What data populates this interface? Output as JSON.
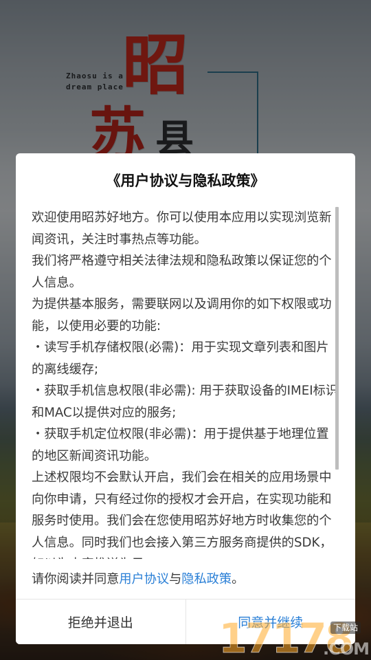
{
  "background": {
    "caption": "Zhaosu is a dream place",
    "calligraphy": [
      "昭",
      "苏",
      "县"
    ]
  },
  "dialog": {
    "title": "《用户协议与隐私政策》",
    "paragraphs": [
      "欢迎使用昭苏好地方。你可以使用本应用以实现浏览新闻资讯，关注时事热点等功能。",
      "我们将严格遵守相关法律法规和隐私政策以保证您的个人信息。",
      "为提供基本服务，需要联网以及调用你的如下权限或功能，以使用必要的功能:",
      "  ・读写手机存储权限(必需)：用于实现文章列表和图片的离线缓存;",
      "  ・获取手机信息权限(非必需): 用于获取设备的IMEI标识和MAC以提供对应的服务;",
      "  ・获取手机定位权限(非必需)：用于提供基于地理位置的地区新闻资讯功能。",
      "上述权限均不会默认开启，我们会在相关的应用场景中向你申请，只有经过你的授权才会开启，在实现功能和服务时使用。我们会在您使用昭苏好地方时收集您的个人信息。同时我们也会接入第三方服务商提供的SDK，如以为内容推送为目"
    ],
    "notice": {
      "prefix": "请你阅读并同意",
      "user_agreement_link": "用户协议",
      "conjunction": "与",
      "privacy_link": "隐私政策",
      "suffix": "。"
    },
    "buttons": {
      "reject": "拒绝并退出",
      "accept": "同意并继续"
    }
  },
  "watermark": {
    "number": "17178",
    "com": ".COM",
    "badge": "下载站"
  },
  "colors": {
    "link": "#2a7fd6",
    "calligraphy_red": "#c0281d"
  }
}
